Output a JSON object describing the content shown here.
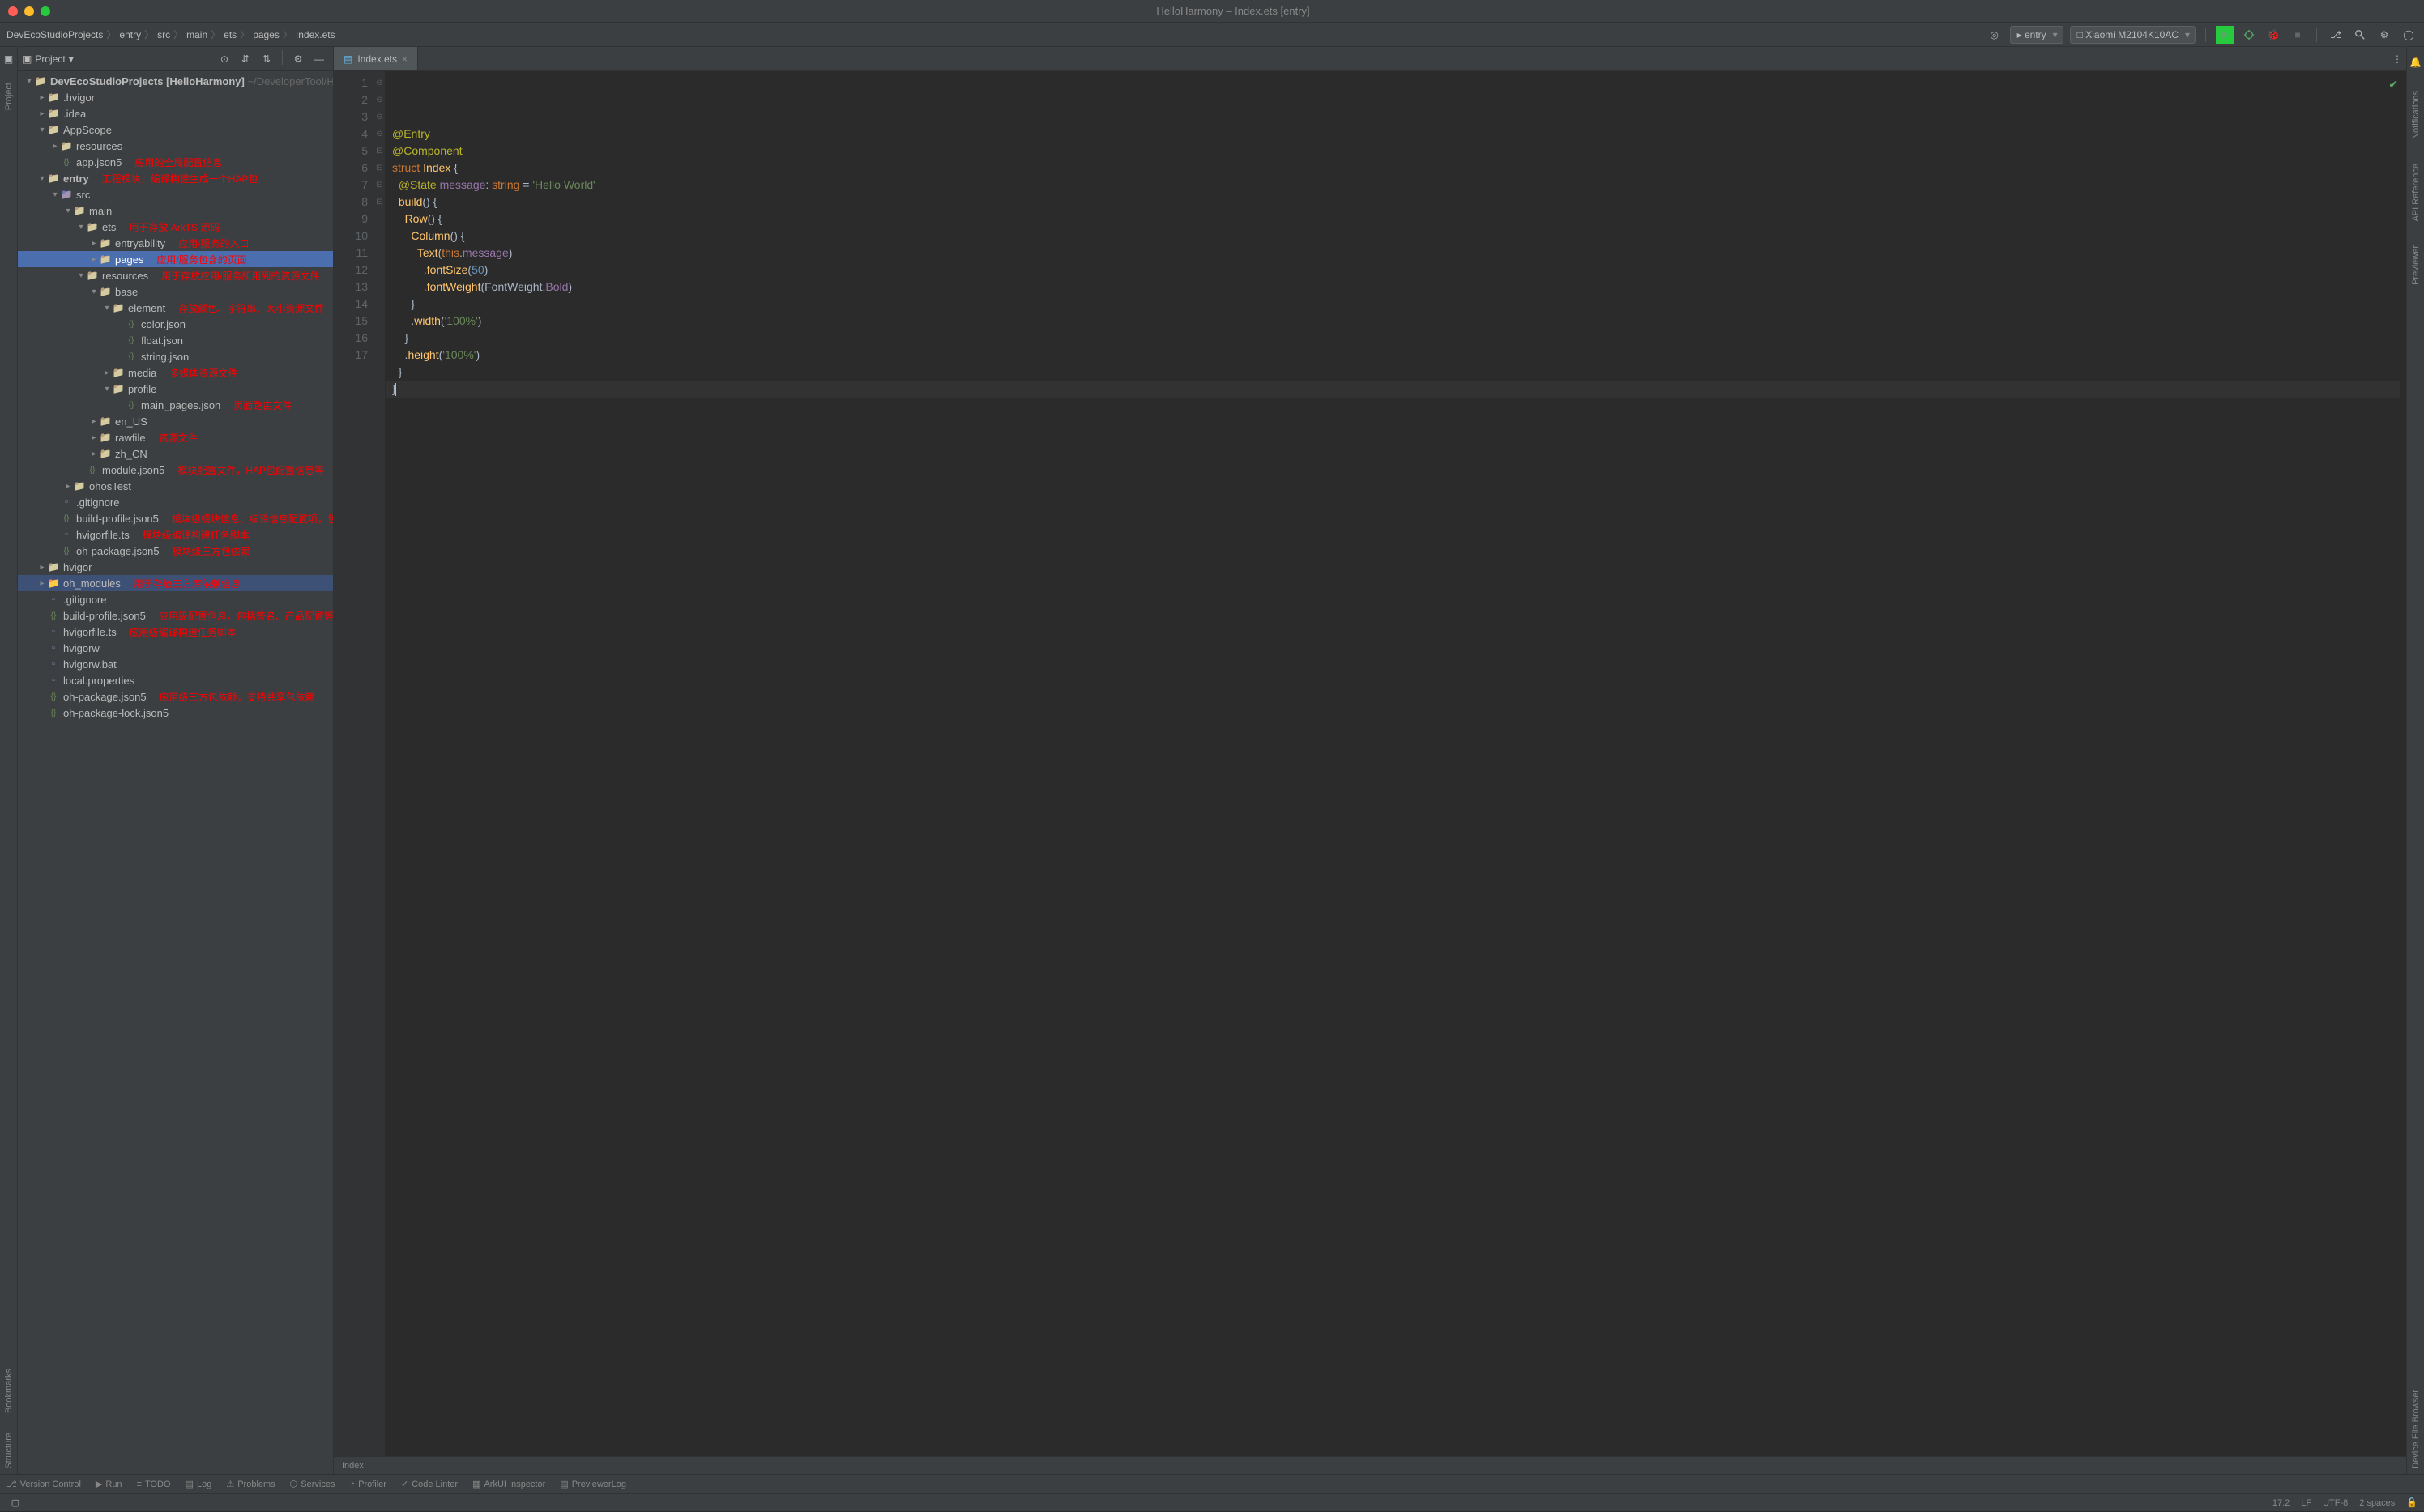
{
  "window": {
    "title": "HelloHarmony – Index.ets [entry]"
  },
  "breadcrumbs": [
    "DevEcoStudioProjects",
    "entry",
    "src",
    "main",
    "ets",
    "pages",
    "Index.ets"
  ],
  "run_config": "entry",
  "device": "Xiaomi M2104K10AC",
  "sidebar": {
    "view_label": "Project",
    "root_name": "DevEcoStudioProjects",
    "root_tag": "[HelloHarmony]",
    "root_path": "~/DeveloperTool/Huawei",
    "rows": [
      {
        "d": 1,
        "a": "r",
        "t": "folder",
        "n": ".hvigor"
      },
      {
        "d": 1,
        "a": "r",
        "t": "folder",
        "n": ".idea"
      },
      {
        "d": 1,
        "a": "d",
        "t": "folder",
        "n": "AppScope"
      },
      {
        "d": 2,
        "a": "r",
        "t": "folder",
        "n": "resources"
      },
      {
        "d": 2,
        "a": "",
        "t": "json",
        "n": "app.json5",
        "ann": "应用的全局配置信息"
      },
      {
        "d": 1,
        "a": "d",
        "t": "folder",
        "n": "entry",
        "bold": true,
        "ann": "工程模块，编译构建生成一个HAP包"
      },
      {
        "d": 2,
        "a": "d",
        "t": "folder-src",
        "n": "src"
      },
      {
        "d": 3,
        "a": "d",
        "t": "folder",
        "n": "main"
      },
      {
        "d": 4,
        "a": "d",
        "t": "folder",
        "n": "ets",
        "ann": "用于存放 ArkTS 源码"
      },
      {
        "d": 5,
        "a": "r",
        "t": "folder",
        "n": "entryability",
        "ann": "应用/服务的入口"
      },
      {
        "d": 5,
        "a": "r",
        "t": "folder",
        "n": "pages",
        "sel": true,
        "ann": "应用/服务包含的页面"
      },
      {
        "d": 4,
        "a": "d",
        "t": "folder",
        "n": "resources",
        "ann": "用于存放应用/服务所用到的资源文件"
      },
      {
        "d": 5,
        "a": "d",
        "t": "folder",
        "n": "base"
      },
      {
        "d": 6,
        "a": "d",
        "t": "folder",
        "n": "element",
        "ann": "存放颜色、字符串、大小资源文件"
      },
      {
        "d": 7,
        "a": "",
        "t": "json",
        "n": "color.json"
      },
      {
        "d": 7,
        "a": "",
        "t": "json",
        "n": "float.json"
      },
      {
        "d": 7,
        "a": "",
        "t": "json",
        "n": "string.json"
      },
      {
        "d": 6,
        "a": "r",
        "t": "folder",
        "n": "media",
        "ann": "多媒体资源文件"
      },
      {
        "d": 6,
        "a": "d",
        "t": "folder",
        "n": "profile"
      },
      {
        "d": 7,
        "a": "",
        "t": "json",
        "n": "main_pages.json",
        "ann": "页面路由文件"
      },
      {
        "d": 5,
        "a": "r",
        "t": "folder",
        "n": "en_US"
      },
      {
        "d": 5,
        "a": "r",
        "t": "folder",
        "n": "rawfile",
        "ann": "资源文件"
      },
      {
        "d": 5,
        "a": "r",
        "t": "folder",
        "n": "zh_CN"
      },
      {
        "d": 4,
        "a": "",
        "t": "json",
        "n": "module.json5",
        "ann": "模块配置文件，HAP包配置信息等"
      },
      {
        "d": 3,
        "a": "r",
        "t": "folder",
        "n": "ohosTest"
      },
      {
        "d": 2,
        "a": "",
        "t": "file",
        "n": ".gitignore"
      },
      {
        "d": 2,
        "a": "",
        "t": "json",
        "n": "build-profile.json5",
        "ann": "模块级模块信息、编译信息配置项，包括buildOption、targets配置等"
      },
      {
        "d": 2,
        "a": "",
        "t": "ts",
        "n": "hvigorfile.ts",
        "ann": "模块级编译构建任务脚本"
      },
      {
        "d": 2,
        "a": "",
        "t": "json",
        "n": "oh-package.json5",
        "ann": "模块级三方包依赖"
      },
      {
        "d": 1,
        "a": "r",
        "t": "folder",
        "n": "hvigor"
      },
      {
        "d": 1,
        "a": "r",
        "t": "folder-orange",
        "n": "oh_modules",
        "hl": true,
        "ann": "用于存放三方库依赖信息"
      },
      {
        "d": 1,
        "a": "",
        "t": "file",
        "n": ".gitignore"
      },
      {
        "d": 1,
        "a": "",
        "t": "json",
        "n": "build-profile.json5",
        "ann": "应用级配置信息，包括签名、产品配置等"
      },
      {
        "d": 1,
        "a": "",
        "t": "ts",
        "n": "hvigorfile.ts",
        "ann": "应用级编译构建任务脚本"
      },
      {
        "d": 1,
        "a": "",
        "t": "file",
        "n": "hvigorw"
      },
      {
        "d": 1,
        "a": "",
        "t": "file",
        "n": "hvigorw.bat"
      },
      {
        "d": 1,
        "a": "",
        "t": "file",
        "n": "local.properties"
      },
      {
        "d": 1,
        "a": "",
        "t": "json",
        "n": "oh-package.json5",
        "ann": "应用级三方包依赖，支持共享包依赖"
      },
      {
        "d": 1,
        "a": "",
        "t": "json",
        "n": "oh-package-lock.json5"
      }
    ]
  },
  "editor": {
    "tab": "Index.ets",
    "breadcrumb": "Index",
    "lines": [
      [
        {
          "c": "k-decorator",
          "t": "@Entry"
        }
      ],
      [
        {
          "c": "k-decorator",
          "t": "@Component"
        }
      ],
      [
        {
          "c": "k-keyword",
          "t": "struct"
        },
        {
          "t": " "
        },
        {
          "c": "k-struct",
          "t": "Index"
        },
        {
          "t": " "
        },
        {
          "c": "",
          "t": "{"
        }
      ],
      [
        {
          "t": "  "
        },
        {
          "c": "k-decorator",
          "t": "@State"
        },
        {
          "t": " "
        },
        {
          "c": "k-prop",
          "t": "message"
        },
        {
          "t": ": "
        },
        {
          "c": "k-keyword",
          "t": "string"
        },
        {
          "t": " = "
        },
        {
          "c": "k-string",
          "t": "'Hello World'"
        }
      ],
      [
        {
          "t": ""
        }
      ],
      [
        {
          "t": "  "
        },
        {
          "c": "k-method",
          "t": "build"
        },
        {
          "t": "() {"
        }
      ],
      [
        {
          "t": "    "
        },
        {
          "c": "k-method",
          "t": "Row"
        },
        {
          "t": "() {"
        }
      ],
      [
        {
          "t": "      "
        },
        {
          "c": "k-method",
          "t": "Column"
        },
        {
          "t": "() {"
        }
      ],
      [
        {
          "t": "        "
        },
        {
          "c": "k-method",
          "t": "Text"
        },
        {
          "t": "("
        },
        {
          "c": "k-this",
          "t": "this"
        },
        {
          "t": "."
        },
        {
          "c": "k-prop",
          "t": "message"
        },
        {
          "t": ")"
        }
      ],
      [
        {
          "t": "          ."
        },
        {
          "c": "k-chain",
          "t": "fontSize"
        },
        {
          "t": "("
        },
        {
          "c": "k-number",
          "t": "50"
        },
        {
          "t": ")"
        }
      ],
      [
        {
          "t": "          ."
        },
        {
          "c": "k-chain",
          "t": "fontWeight"
        },
        {
          "t": "(FontWeight."
        },
        {
          "c": "k-prop",
          "t": "Bold"
        },
        {
          "t": ")"
        }
      ],
      [
        {
          "t": "      }"
        }
      ],
      [
        {
          "t": "      ."
        },
        {
          "c": "k-chain",
          "t": "width"
        },
        {
          "t": "("
        },
        {
          "c": "k-string",
          "t": "'100%'"
        },
        {
          "t": ")"
        }
      ],
      [
        {
          "t": "    }"
        }
      ],
      [
        {
          "t": "    ."
        },
        {
          "c": "k-chain",
          "t": "height"
        },
        {
          "t": "("
        },
        {
          "c": "k-string",
          "t": "'100%'"
        },
        {
          "t": ")"
        }
      ],
      [
        {
          "t": "  }"
        }
      ],
      [
        {
          "t": "}"
        }
      ]
    ]
  },
  "left_gutter": [
    "Project"
  ],
  "left_gutter_bottom": [
    "Bookmarks",
    "Structure"
  ],
  "right_gutter": [
    "Notifications",
    "API Reference",
    "Previewer",
    "Device File Browser"
  ],
  "bottom_tools": [
    "Version Control",
    "Run",
    "TODO",
    "Log",
    "Problems",
    "Services",
    "Profiler",
    "Code Linter",
    "ArkUI Inspector",
    "PreviewerLog"
  ],
  "status": {
    "pos": "17:2",
    "lf": "LF",
    "enc": "UTF-8",
    "indent": "2 spaces"
  }
}
